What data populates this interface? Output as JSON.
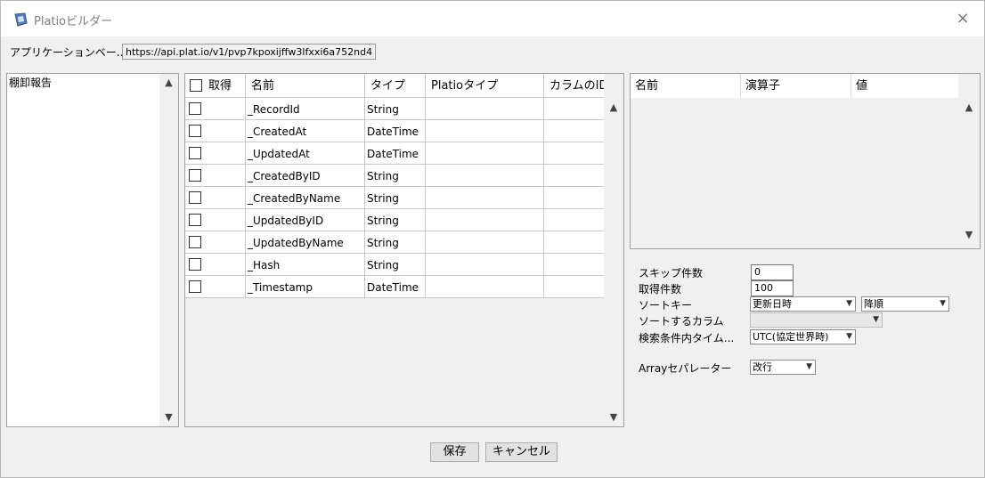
{
  "window": {
    "title": "Platioビルダー",
    "icon": "app-icon",
    "close_icon": "×"
  },
  "url_bar": {
    "label": "アプリケーションベー...",
    "value": "https://api.plat.io/v1/pvp7kpoxijffw3lfxxi6a752nd4"
  },
  "tables_list": {
    "items": [
      "棚卸報告"
    ],
    "scroll_up": "⌃",
    "scroll_down": "⌄"
  },
  "fields_grid": {
    "headers": [
      "取得",
      "名前",
      "タイプ",
      "Platioタイプ",
      "カラムのID"
    ],
    "rows": [
      {
        "checked": false,
        "name": "_RecordId",
        "type": "String",
        "platio_type": "",
        "column_id": ""
      },
      {
        "checked": false,
        "name": "_CreatedAt",
        "type": "DateTime",
        "platio_type": "",
        "column_id": ""
      },
      {
        "checked": false,
        "name": "_UpdatedAt",
        "type": "DateTime",
        "platio_type": "",
        "column_id": ""
      },
      {
        "checked": false,
        "name": "_CreatedByID",
        "type": "String",
        "platio_type": "",
        "column_id": ""
      },
      {
        "checked": false,
        "name": "_CreatedByName",
        "type": "String",
        "platio_type": "",
        "column_id": ""
      },
      {
        "checked": false,
        "name": "_UpdatedByID",
        "type": "String",
        "platio_type": "",
        "column_id": ""
      },
      {
        "checked": false,
        "name": "_UpdatedByName",
        "type": "String",
        "platio_type": "",
        "column_id": ""
      },
      {
        "checked": false,
        "name": "_Hash",
        "type": "String",
        "platio_type": "",
        "column_id": ""
      },
      {
        "checked": false,
        "name": "_Timestamp",
        "type": "DateTime",
        "platio_type": "",
        "column_id": ""
      }
    ]
  },
  "filter_table": {
    "headers": [
      "名前",
      "演算子",
      "値"
    ]
  },
  "options": {
    "skip": {
      "label": "スキップ件数",
      "value": "0"
    },
    "take": {
      "label": "取得件数",
      "value": "100"
    },
    "sort_key": {
      "label": "ソートキー",
      "value": "更新日時",
      "order": "降順"
    },
    "sort_column": {
      "label": "ソートするカラム",
      "value": ""
    },
    "timezone": {
      "label": "検索条件内タイム...",
      "value": "UTC(協定世界時)"
    },
    "array_separator": {
      "label": "Arrayセパレーター",
      "value": "改行"
    }
  },
  "buttons": {
    "save": "保存",
    "cancel": "キャンセル"
  }
}
